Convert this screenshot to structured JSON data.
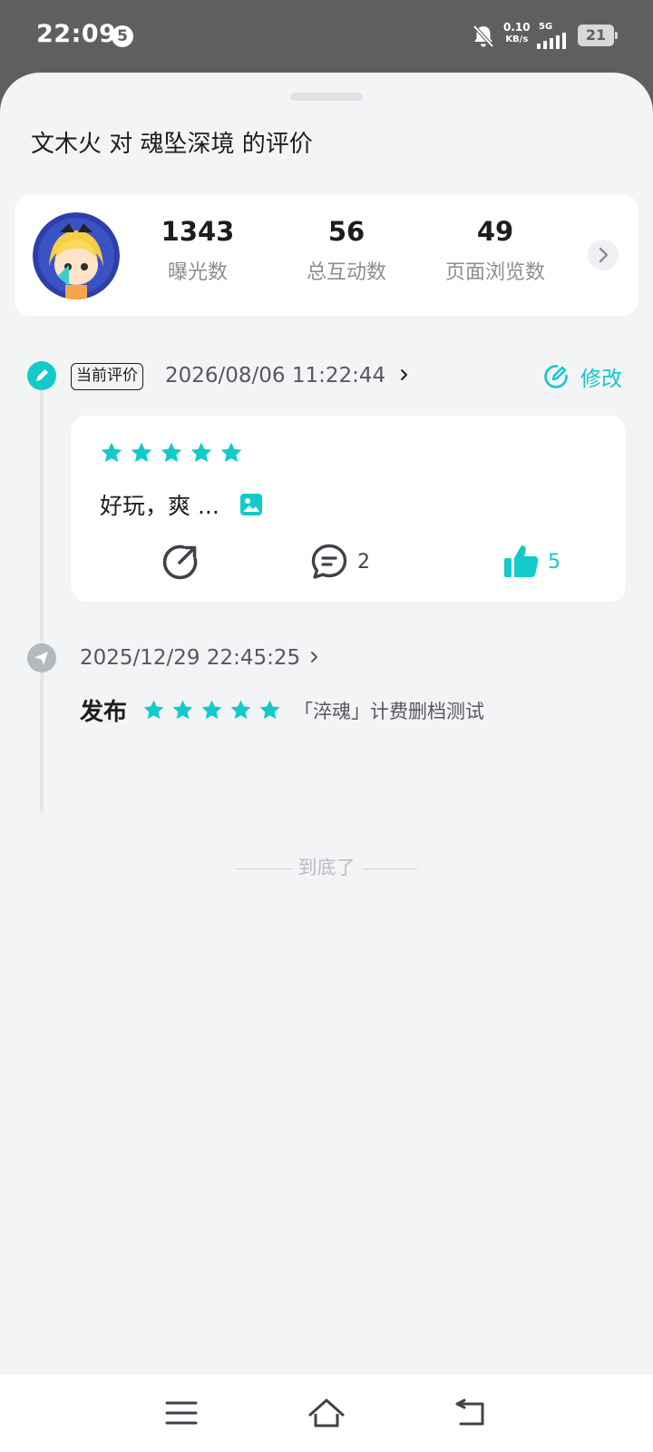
{
  "status_bar": {
    "time": "22:09",
    "notification_count": "5",
    "net_speed_value": "0.10",
    "net_speed_unit": "KB/s",
    "network_type": "5G",
    "battery": "21"
  },
  "page": {
    "title": "文木火 对 魂坠深境 的评价"
  },
  "stats": {
    "items": [
      {
        "value": "1343",
        "label": "曝光数"
      },
      {
        "value": "56",
        "label": "总互动数"
      },
      {
        "value": "49",
        "label": "页面浏览数"
      }
    ]
  },
  "current_review": {
    "badge": "当前评价",
    "datetime": "2026/08/06 11:22:44",
    "edit_label": "修改",
    "rating": 5,
    "text": "好玩，爽 ...",
    "comment_count": "2",
    "like_count": "5"
  },
  "history": {
    "datetime": "2025/12/29 22:45:25",
    "action": "发布",
    "rating": 5,
    "game_version": "「淬魂」计费删档测试"
  },
  "footer": {
    "end_text": "到底了"
  },
  "colors": {
    "accent": "#14c9c9",
    "status_bar": "#5f5f5f",
    "sheet_bg": "#f3f4f6"
  }
}
